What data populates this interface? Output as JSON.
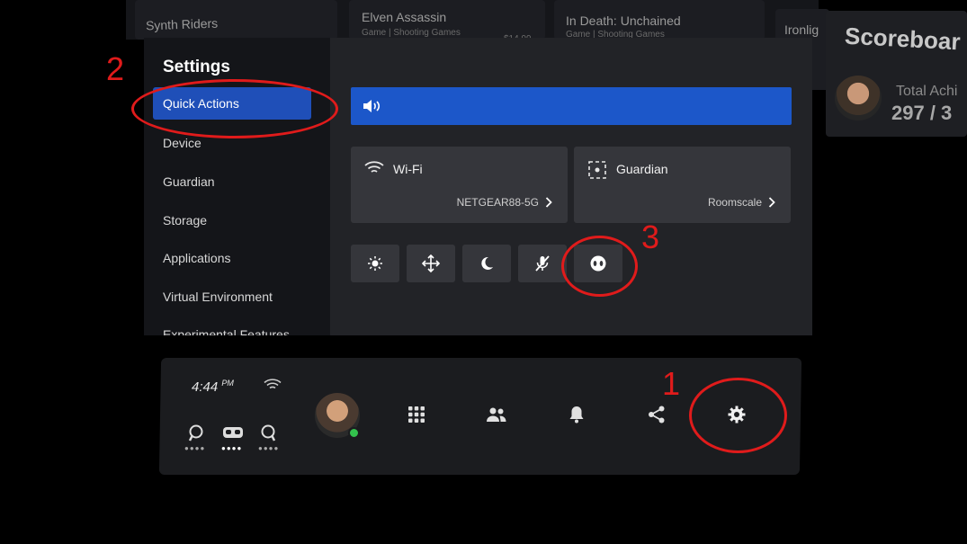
{
  "background": {
    "cards": [
      {
        "title": "Synth Riders",
        "subtitle": ""
      },
      {
        "title": "Elven Assassin",
        "subtitle": "Game | Shooting Games",
        "price": "$14.99"
      },
      {
        "title": "In Death: Unchained",
        "subtitle": "Game | Shooting Games"
      },
      {
        "title": "Ironlig",
        "subtitle": ""
      }
    ],
    "scoreboard": {
      "title": "Scoreboar",
      "label": "Total Achi",
      "value": "297 / 3"
    }
  },
  "settings": {
    "title": "Settings",
    "menu": [
      {
        "label": "Quick Actions",
        "active": true
      },
      {
        "label": "Device"
      },
      {
        "label": "Guardian"
      },
      {
        "label": "Storage"
      },
      {
        "label": "Applications"
      },
      {
        "label": "Virtual Environment"
      },
      {
        "label": "Experimental Features"
      }
    ],
    "volume": {
      "icon": "speaker-icon"
    },
    "tiles": [
      {
        "label": "Wi-Fi",
        "value": "NETGEAR88-5G",
        "icon": "wifi-icon"
      },
      {
        "label": "Guardian",
        "value": "Roomscale",
        "icon": "guardian-icon"
      }
    ],
    "quick_buttons": [
      {
        "icon": "brightness-icon"
      },
      {
        "icon": "move-icon"
      },
      {
        "icon": "night-mode-icon"
      },
      {
        "icon": "mic-mute-icon"
      },
      {
        "icon": "passthrough-icon"
      }
    ]
  },
  "taskbar": {
    "time": "4:44",
    "ampm": "PM",
    "icons": [
      "apps-grid-icon",
      "people-icon",
      "bell-icon",
      "share-icon",
      "settings-gear-icon"
    ]
  },
  "annotations": {
    "one": "1",
    "two": "2",
    "three": "3"
  },
  "colors": {
    "accent": "#1c57c9",
    "annotation": "#e01b1b",
    "online": "#33c24d"
  }
}
